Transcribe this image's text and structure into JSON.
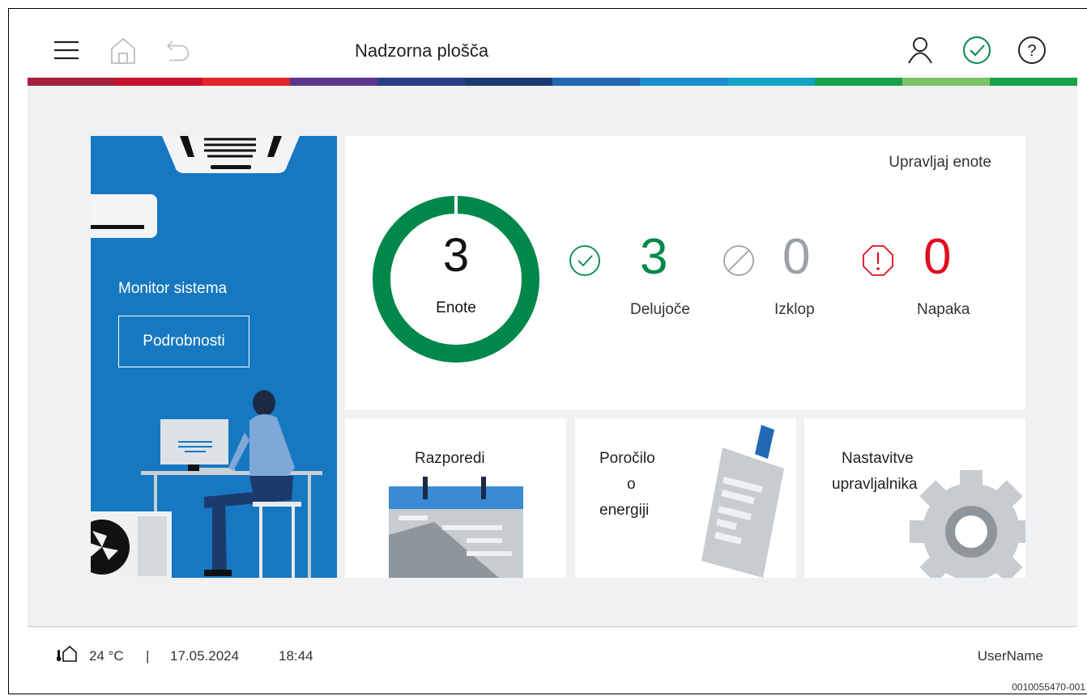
{
  "header": {
    "title": "Nadzorna plošča",
    "icons": [
      "menu-icon",
      "home-icon",
      "back-icon",
      "user-icon",
      "status-ok-icon",
      "help-icon"
    ]
  },
  "stripe_colors": [
    "#a71e3b",
    "#c8102e",
    "#e52329",
    "#5b3690",
    "#273f8b",
    "#1c3a73",
    "#2269b3",
    "#1a8ccd",
    "#0fa3c6",
    "#18a14b",
    "#7cc466",
    "#18a14b"
  ],
  "monitor": {
    "title": "Monitor sistema",
    "details_button": "Podrobnosti"
  },
  "units": {
    "manage_link": "Upravljaj enote",
    "total": {
      "value": "3",
      "label": "Enote",
      "running_fraction": 1.0
    },
    "stats": [
      {
        "value": "3",
        "label": "Delujoče",
        "icon": "check-circle-icon",
        "color": "#00884a"
      },
      {
        "value": "0",
        "label": "Izklop",
        "icon": "off-icon",
        "color": "#9aa2a8"
      },
      {
        "value": "0",
        "label": "Napaka",
        "icon": "error-octagon-icon",
        "color": "#e00f1e"
      }
    ]
  },
  "tiles": {
    "schedules": "Razporedi",
    "energy_line1": "Poročilo",
    "energy_line2": "o",
    "energy_line3": "energiji",
    "settings_line1": "Nastavitve",
    "settings_line2": "upravljalnika"
  },
  "footer": {
    "temperature": "24 °C",
    "separator": "|",
    "date": "17.05.2024",
    "time": "18:44",
    "username": "UserName"
  },
  "doc_id": "0010055470-001",
  "colors": {
    "accent_blue": "#1678c1",
    "ok_green": "#00884a",
    "error_red": "#e00f1e",
    "off_grey": "#9aa2a8",
    "background": "#eff1f2"
  }
}
